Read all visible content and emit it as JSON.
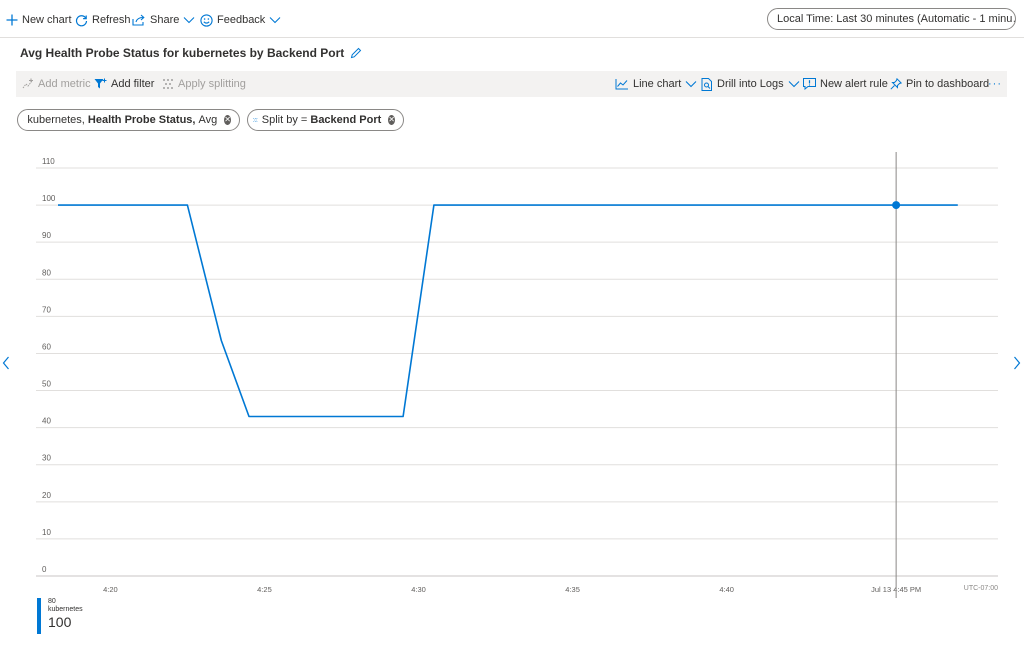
{
  "toolbar": {
    "new_chart": "New chart",
    "refresh": "Refresh",
    "share": "Share",
    "feedback": "Feedback",
    "time_range": "Local Time: Last 30 minutes (Automatic - 1 minu…"
  },
  "chart_title": "Avg Health Probe Status for kubernetes by Backend Port",
  "commands": {
    "add_metric": "Add metric",
    "add_filter": "Add filter",
    "apply_splitting": "Apply splitting",
    "line_chart": "Line chart",
    "drill_into_logs": "Drill into Logs",
    "new_alert_rule": "New alert rule",
    "pin_to_dashboard": "Pin to dashboard",
    "more": "···"
  },
  "pills": {
    "metric": {
      "resource": "kubernetes,",
      "metric": "Health Probe Status,",
      "agg": "Avg"
    },
    "split": {
      "prefix": "Split by =",
      "value": "Backend Port"
    }
  },
  "legend": {
    "port": "80",
    "resource": "kubernetes",
    "value": "100"
  },
  "colors": {
    "accent": "#0078d4",
    "grid": "#e1dfdd",
    "cursor": "#8a8886"
  },
  "chart_data": {
    "type": "line",
    "x_minutes": [
      18.3,
      22.5,
      23.6,
      24.5,
      29.5,
      30.5,
      45.5,
      47.5
    ],
    "values": [
      100,
      100,
      63.5,
      43,
      43,
      100,
      100,
      100
    ],
    "xlim": [
      18.3,
      47.8
    ],
    "x_ticks": [
      {
        "m": 20,
        "label": "4:20"
      },
      {
        "m": 25,
        "label": "4:25"
      },
      {
        "m": 30,
        "label": "4:30"
      },
      {
        "m": 35,
        "label": "4:35"
      },
      {
        "m": 40,
        "label": "4:40"
      },
      {
        "m": 45.5,
        "label": "Jul 13 4:45 PM"
      }
    ],
    "timezone_label": "UTC-07:00",
    "ylim": [
      0,
      110
    ],
    "y_ticks": [
      0,
      10,
      20,
      30,
      40,
      50,
      60,
      70,
      80,
      90,
      100,
      110
    ],
    "cursor": {
      "m": 45.5,
      "value": 100
    },
    "grid": true
  }
}
